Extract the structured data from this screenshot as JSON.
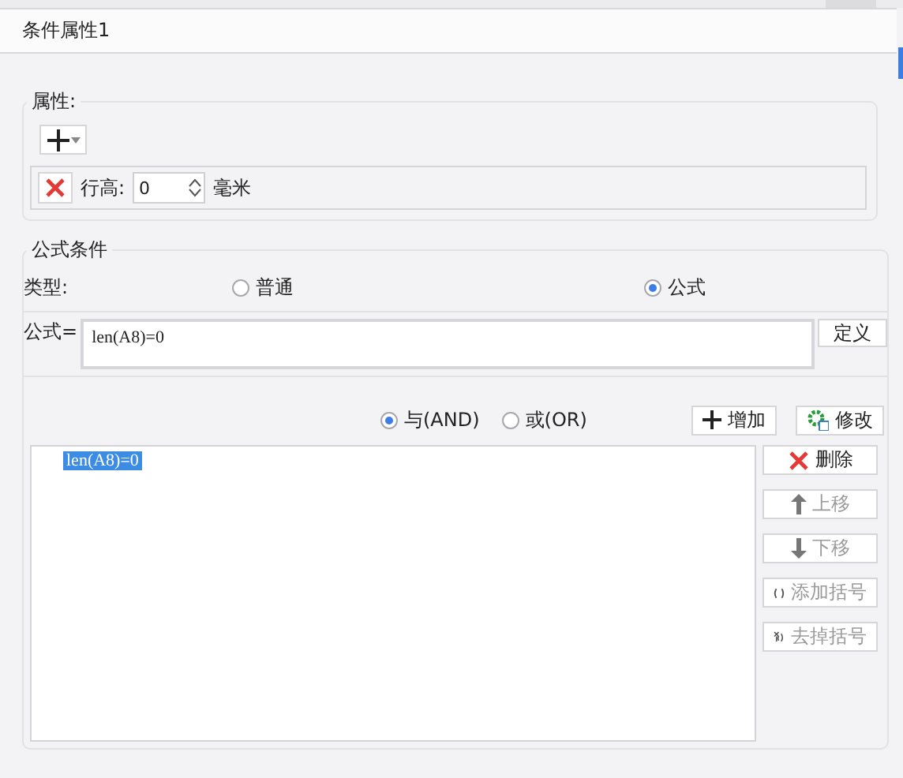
{
  "title": "条件属性1",
  "attributes": {
    "legend": "属性:",
    "rows": [
      {
        "label": "行高:",
        "value": "0",
        "unit": "毫米"
      }
    ]
  },
  "formula_condition": {
    "legend": "公式条件",
    "type_label": "类型:",
    "type_options": [
      {
        "label": "普通",
        "selected": false
      },
      {
        "label": "公式",
        "selected": true
      }
    ],
    "formula_label": "公式=",
    "formula_value": "len(A8)=0",
    "define_button": "定义",
    "logic_options": [
      {
        "label": "与(AND)",
        "selected": true
      },
      {
        "label": "或(OR)",
        "selected": false
      }
    ],
    "add_button": "增加",
    "modify_button": "修改",
    "conditions": [
      {
        "text": "len(A8)=0",
        "selected": true
      }
    ],
    "side_buttons": [
      {
        "kind": "delete",
        "label": "删除",
        "disabled": false
      },
      {
        "kind": "up",
        "label": "上移",
        "disabled": true
      },
      {
        "kind": "down",
        "label": "下移",
        "disabled": true
      },
      {
        "kind": "add_paren",
        "label": "添加括号",
        "disabled": true
      },
      {
        "kind": "remove_paren",
        "label": "去掉括号",
        "disabled": true
      }
    ]
  }
}
